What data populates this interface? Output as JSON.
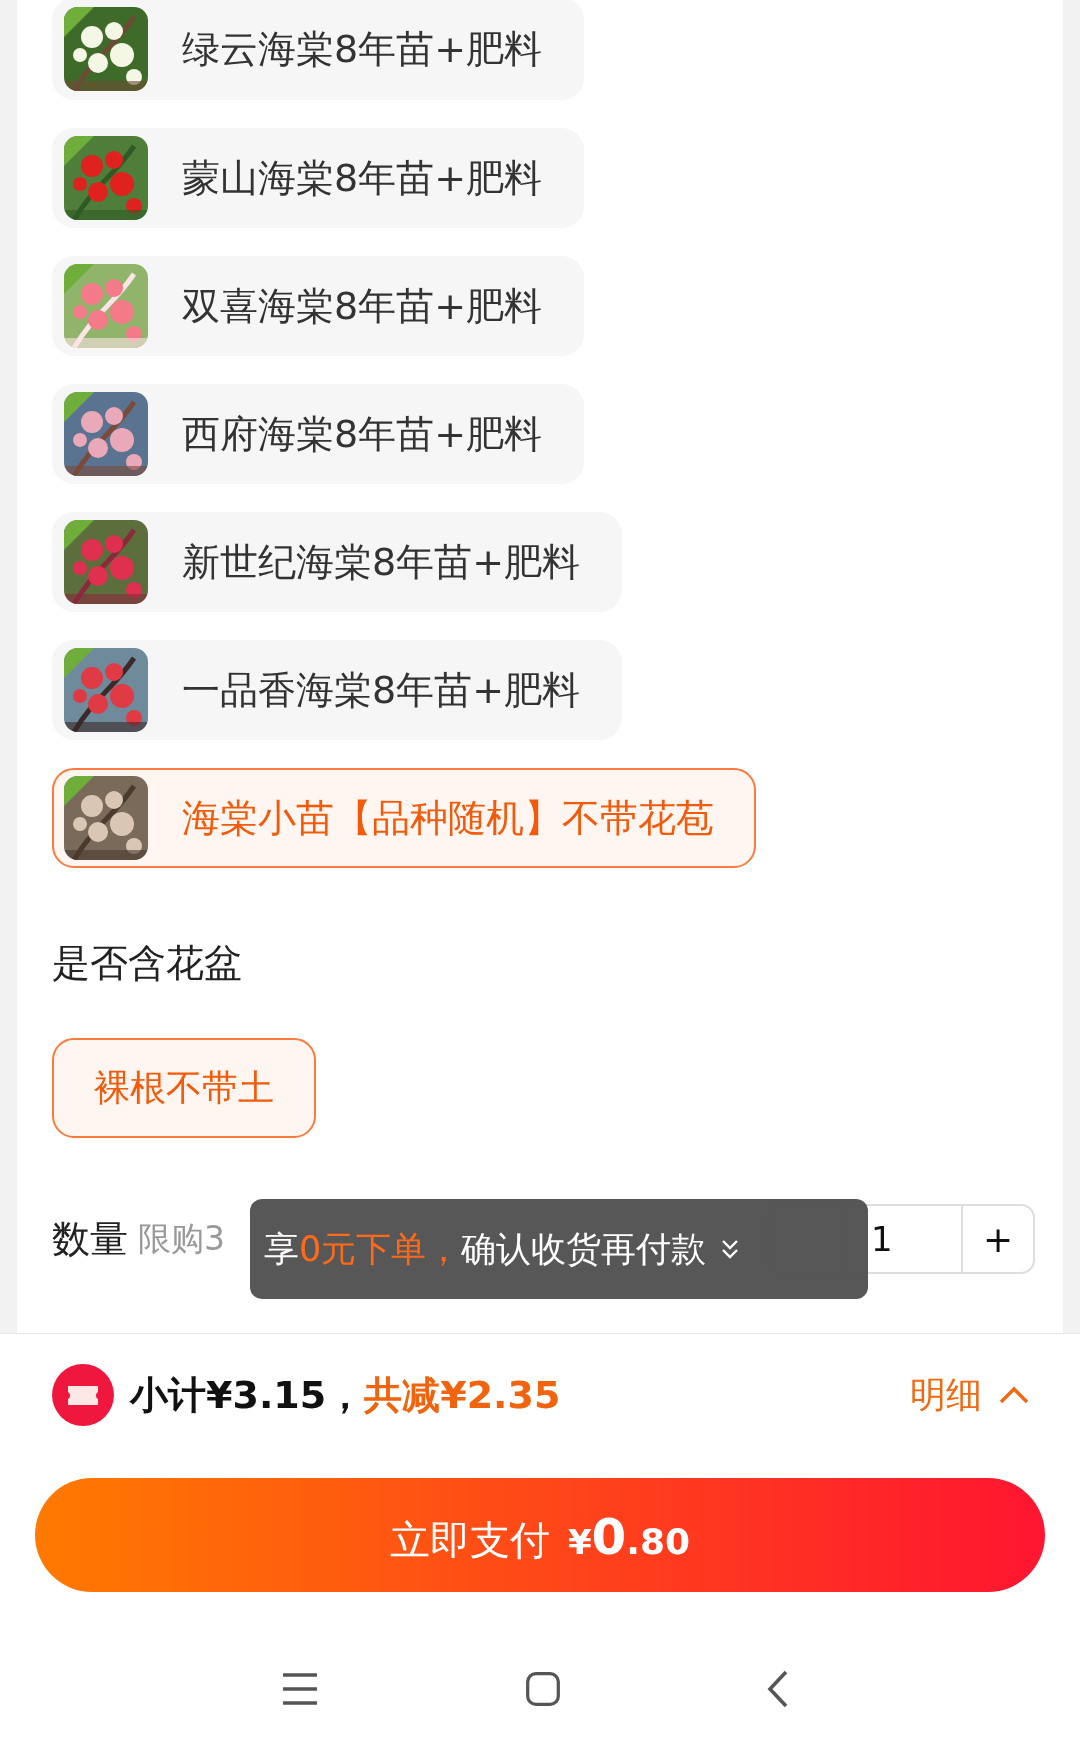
{
  "variants": [
    {
      "label": "绿云海棠8年苗+肥料",
      "selected": false
    },
    {
      "label": "蒙山海棠8年苗+肥料",
      "selected": false
    },
    {
      "label": "双喜海棠8年苗+肥料",
      "selected": false
    },
    {
      "label": "西府海棠8年苗+肥料",
      "selected": false
    },
    {
      "label": "新世纪海棠8年苗+肥料",
      "selected": false
    },
    {
      "label": "一品香海棠8年苗+肥料",
      "selected": false
    },
    {
      "label": "海棠小苗【品种随机】不带花苞",
      "selected": true
    }
  ],
  "pot_section": {
    "title": "是否含花盆",
    "options": [
      {
        "label": "裸根不带土",
        "selected": true
      }
    ]
  },
  "quantity": {
    "label": "数量",
    "limit": "限购3",
    "value": "1",
    "plus": "+"
  },
  "toast": {
    "parts": [
      {
        "text": "享",
        "highlight": false
      },
      {
        "text": "0元下单，",
        "highlight": true
      },
      {
        "text": "确认收货再付款",
        "highlight": false
      }
    ]
  },
  "summary": {
    "subtotal": "小计¥3.15，",
    "discount": "共减¥2.35",
    "details": "明细"
  },
  "pay_button": {
    "label": "立即支付",
    "currency": "¥",
    "integer": "0",
    "decimal": ".80"
  }
}
